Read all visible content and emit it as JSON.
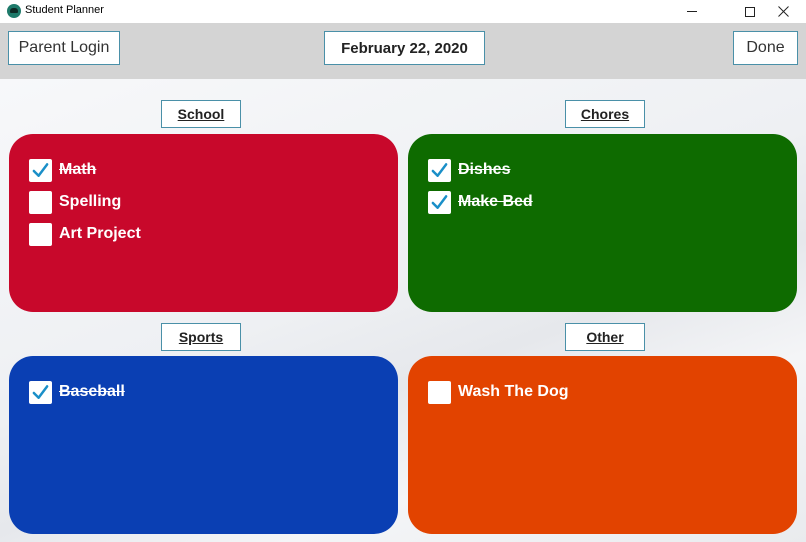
{
  "window": {
    "title": "Student Planner"
  },
  "header": {
    "parent_login_label": "Parent Login",
    "date": "February 22, 2020",
    "done_label": "Done"
  },
  "categories": {
    "school": {
      "label": "School",
      "color": "#c8082b",
      "tasks": [
        {
          "label": "Math",
          "checked": true
        },
        {
          "label": "Spelling",
          "checked": false
        },
        {
          "label": "Art Project",
          "checked": false
        }
      ]
    },
    "chores": {
      "label": "Chores",
      "color": "#0e6b00",
      "tasks": [
        {
          "label": "Dishes",
          "checked": true
        },
        {
          "label": "Make Bed",
          "checked": true
        }
      ]
    },
    "sports": {
      "label": "Sports",
      "color": "#0a3fb3",
      "tasks": [
        {
          "label": "Baseball",
          "checked": true
        }
      ]
    },
    "other": {
      "label": "Other",
      "color": "#e24300",
      "tasks": [
        {
          "label": "Wash The Dog",
          "checked": false
        }
      ]
    }
  },
  "colors": {
    "checkmark": "#1a8fc8",
    "button_border": "#4a90a8",
    "header_bg": "#d4d4d4"
  }
}
